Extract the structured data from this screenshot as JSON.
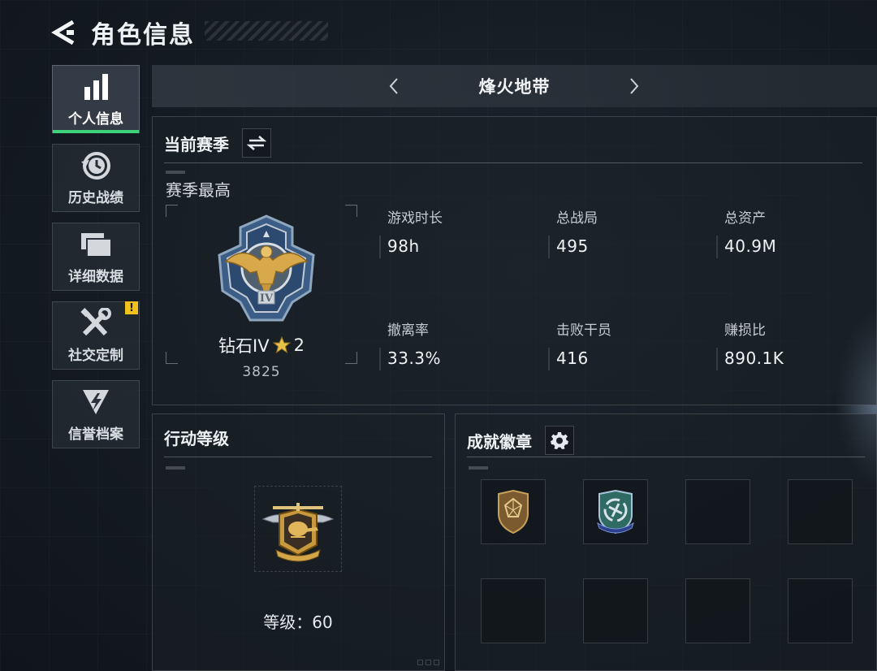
{
  "header": {
    "title": "角色信息"
  },
  "sidebar": {
    "items": [
      {
        "label": "个人信息",
        "icon": "bar-chart-icon",
        "active": true
      },
      {
        "label": "历史战绩",
        "icon": "history-clock-icon",
        "active": false
      },
      {
        "label": "详细数据",
        "icon": "folders-icon",
        "active": false
      },
      {
        "label": "社交定制",
        "icon": "tools-icon",
        "active": false,
        "badge": "!"
      },
      {
        "label": "信誉档案",
        "icon": "credit-emblem-icon",
        "active": false
      }
    ]
  },
  "mode": {
    "title": "烽火地带"
  },
  "season": {
    "title": "当前赛季",
    "subtitle": "赛季最高",
    "rank": {
      "name": "钻石IV",
      "stars": "2",
      "score": "3825",
      "tier_numeral": "IV"
    },
    "stats": [
      {
        "label": "游戏时长",
        "value": "98h"
      },
      {
        "label": "总战局",
        "value": "495"
      },
      {
        "label": "总资产",
        "value": "40.9M"
      },
      {
        "label": "撤离率",
        "value": "33.3%"
      },
      {
        "label": "击败干员",
        "value": "416"
      },
      {
        "label": "赚损比",
        "value": "890.1K"
      }
    ]
  },
  "level": {
    "title": "行动等级",
    "text": "等级：60"
  },
  "badges": {
    "title": "成就徽章",
    "slots": [
      "shield-gem-badge-icon",
      "recycle-badge-icon",
      "",
      "",
      "",
      "",
      "",
      ""
    ]
  },
  "colors": {
    "accent_green": "#3ed37a",
    "alert_yellow": "#f1c21b",
    "gold": "#d8a94a",
    "star": "#e8c14a"
  }
}
